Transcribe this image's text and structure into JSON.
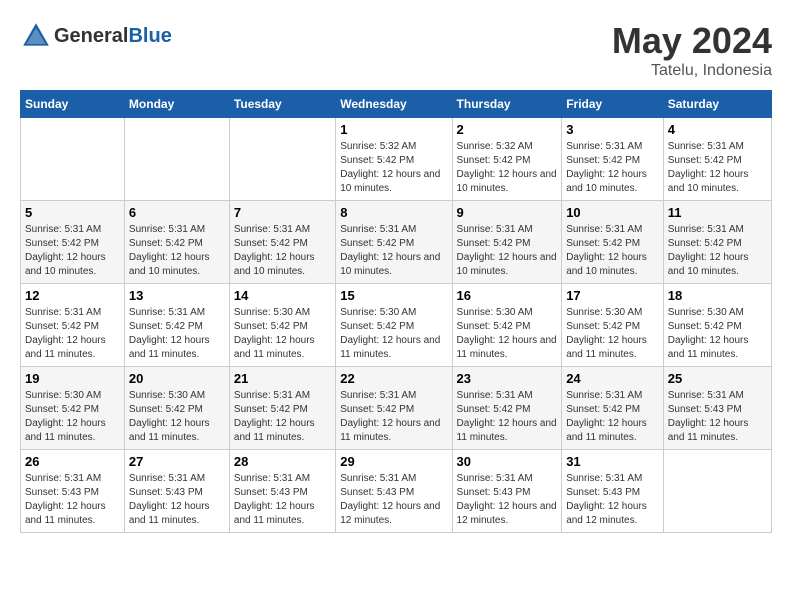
{
  "header": {
    "logo_general": "General",
    "logo_blue": "Blue",
    "month": "May 2024",
    "location": "Tatelu, Indonesia"
  },
  "weekdays": [
    "Sunday",
    "Monday",
    "Tuesday",
    "Wednesday",
    "Thursday",
    "Friday",
    "Saturday"
  ],
  "weeks": [
    [
      {
        "day": "",
        "sunrise": "",
        "sunset": "",
        "daylight": ""
      },
      {
        "day": "",
        "sunrise": "",
        "sunset": "",
        "daylight": ""
      },
      {
        "day": "",
        "sunrise": "",
        "sunset": "",
        "daylight": ""
      },
      {
        "day": "1",
        "sunrise": "Sunrise: 5:32 AM",
        "sunset": "Sunset: 5:42 PM",
        "daylight": "Daylight: 12 hours and 10 minutes."
      },
      {
        "day": "2",
        "sunrise": "Sunrise: 5:32 AM",
        "sunset": "Sunset: 5:42 PM",
        "daylight": "Daylight: 12 hours and 10 minutes."
      },
      {
        "day": "3",
        "sunrise": "Sunrise: 5:31 AM",
        "sunset": "Sunset: 5:42 PM",
        "daylight": "Daylight: 12 hours and 10 minutes."
      },
      {
        "day": "4",
        "sunrise": "Sunrise: 5:31 AM",
        "sunset": "Sunset: 5:42 PM",
        "daylight": "Daylight: 12 hours and 10 minutes."
      }
    ],
    [
      {
        "day": "5",
        "sunrise": "Sunrise: 5:31 AM",
        "sunset": "Sunset: 5:42 PM",
        "daylight": "Daylight: 12 hours and 10 minutes."
      },
      {
        "day": "6",
        "sunrise": "Sunrise: 5:31 AM",
        "sunset": "Sunset: 5:42 PM",
        "daylight": "Daylight: 12 hours and 10 minutes."
      },
      {
        "day": "7",
        "sunrise": "Sunrise: 5:31 AM",
        "sunset": "Sunset: 5:42 PM",
        "daylight": "Daylight: 12 hours and 10 minutes."
      },
      {
        "day": "8",
        "sunrise": "Sunrise: 5:31 AM",
        "sunset": "Sunset: 5:42 PM",
        "daylight": "Daylight: 12 hours and 10 minutes."
      },
      {
        "day": "9",
        "sunrise": "Sunrise: 5:31 AM",
        "sunset": "Sunset: 5:42 PM",
        "daylight": "Daylight: 12 hours and 10 minutes."
      },
      {
        "day": "10",
        "sunrise": "Sunrise: 5:31 AM",
        "sunset": "Sunset: 5:42 PM",
        "daylight": "Daylight: 12 hours and 10 minutes."
      },
      {
        "day": "11",
        "sunrise": "Sunrise: 5:31 AM",
        "sunset": "Sunset: 5:42 PM",
        "daylight": "Daylight: 12 hours and 10 minutes."
      }
    ],
    [
      {
        "day": "12",
        "sunrise": "Sunrise: 5:31 AM",
        "sunset": "Sunset: 5:42 PM",
        "daylight": "Daylight: 12 hours and 11 minutes."
      },
      {
        "day": "13",
        "sunrise": "Sunrise: 5:31 AM",
        "sunset": "Sunset: 5:42 PM",
        "daylight": "Daylight: 12 hours and 11 minutes."
      },
      {
        "day": "14",
        "sunrise": "Sunrise: 5:30 AM",
        "sunset": "Sunset: 5:42 PM",
        "daylight": "Daylight: 12 hours and 11 minutes."
      },
      {
        "day": "15",
        "sunrise": "Sunrise: 5:30 AM",
        "sunset": "Sunset: 5:42 PM",
        "daylight": "Daylight: 12 hours and 11 minutes."
      },
      {
        "day": "16",
        "sunrise": "Sunrise: 5:30 AM",
        "sunset": "Sunset: 5:42 PM",
        "daylight": "Daylight: 12 hours and 11 minutes."
      },
      {
        "day": "17",
        "sunrise": "Sunrise: 5:30 AM",
        "sunset": "Sunset: 5:42 PM",
        "daylight": "Daylight: 12 hours and 11 minutes."
      },
      {
        "day": "18",
        "sunrise": "Sunrise: 5:30 AM",
        "sunset": "Sunset: 5:42 PM",
        "daylight": "Daylight: 12 hours and 11 minutes."
      }
    ],
    [
      {
        "day": "19",
        "sunrise": "Sunrise: 5:30 AM",
        "sunset": "Sunset: 5:42 PM",
        "daylight": "Daylight: 12 hours and 11 minutes."
      },
      {
        "day": "20",
        "sunrise": "Sunrise: 5:30 AM",
        "sunset": "Sunset: 5:42 PM",
        "daylight": "Daylight: 12 hours and 11 minutes."
      },
      {
        "day": "21",
        "sunrise": "Sunrise: 5:31 AM",
        "sunset": "Sunset: 5:42 PM",
        "daylight": "Daylight: 12 hours and 11 minutes."
      },
      {
        "day": "22",
        "sunrise": "Sunrise: 5:31 AM",
        "sunset": "Sunset: 5:42 PM",
        "daylight": "Daylight: 12 hours and 11 minutes."
      },
      {
        "day": "23",
        "sunrise": "Sunrise: 5:31 AM",
        "sunset": "Sunset: 5:42 PM",
        "daylight": "Daylight: 12 hours and 11 minutes."
      },
      {
        "day": "24",
        "sunrise": "Sunrise: 5:31 AM",
        "sunset": "Sunset: 5:42 PM",
        "daylight": "Daylight: 12 hours and 11 minutes."
      },
      {
        "day": "25",
        "sunrise": "Sunrise: 5:31 AM",
        "sunset": "Sunset: 5:43 PM",
        "daylight": "Daylight: 12 hours and 11 minutes."
      }
    ],
    [
      {
        "day": "26",
        "sunrise": "Sunrise: 5:31 AM",
        "sunset": "Sunset: 5:43 PM",
        "daylight": "Daylight: 12 hours and 11 minutes."
      },
      {
        "day": "27",
        "sunrise": "Sunrise: 5:31 AM",
        "sunset": "Sunset: 5:43 PM",
        "daylight": "Daylight: 12 hours and 11 minutes."
      },
      {
        "day": "28",
        "sunrise": "Sunrise: 5:31 AM",
        "sunset": "Sunset: 5:43 PM",
        "daylight": "Daylight: 12 hours and 11 minutes."
      },
      {
        "day": "29",
        "sunrise": "Sunrise: 5:31 AM",
        "sunset": "Sunset: 5:43 PM",
        "daylight": "Daylight: 12 hours and 12 minutes."
      },
      {
        "day": "30",
        "sunrise": "Sunrise: 5:31 AM",
        "sunset": "Sunset: 5:43 PM",
        "daylight": "Daylight: 12 hours and 12 minutes."
      },
      {
        "day": "31",
        "sunrise": "Sunrise: 5:31 AM",
        "sunset": "Sunset: 5:43 PM",
        "daylight": "Daylight: 12 hours and 12 minutes."
      },
      {
        "day": "",
        "sunrise": "",
        "sunset": "",
        "daylight": ""
      }
    ]
  ]
}
